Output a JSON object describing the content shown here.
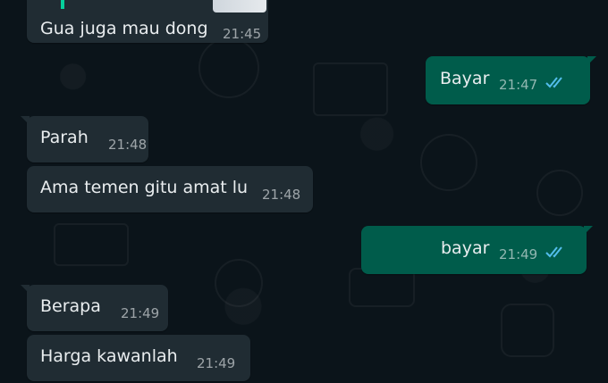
{
  "colors": {
    "background": "#0b141a",
    "incoming_bubble": "#202c33",
    "outgoing_bubble": "#005c4b",
    "read_ticks": "#53bdeb"
  },
  "messages": [
    {
      "direction": "incoming",
      "text": "Gua juga mau dong",
      "time": "21:45"
    },
    {
      "direction": "outgoing",
      "text": "Bayar",
      "time": "21:47",
      "status": "read"
    },
    {
      "direction": "incoming",
      "text": "Parah",
      "time": "21:48"
    },
    {
      "direction": "incoming",
      "text": "Ama temen gitu amat lu",
      "time": "21:48"
    },
    {
      "direction": "outgoing",
      "text": "bayar",
      "time": "21:49",
      "status": "read"
    },
    {
      "direction": "incoming",
      "text": "Berapa",
      "time": "21:49"
    },
    {
      "direction": "incoming",
      "text": "Harga kawanlah",
      "time": "21:49"
    }
  ]
}
